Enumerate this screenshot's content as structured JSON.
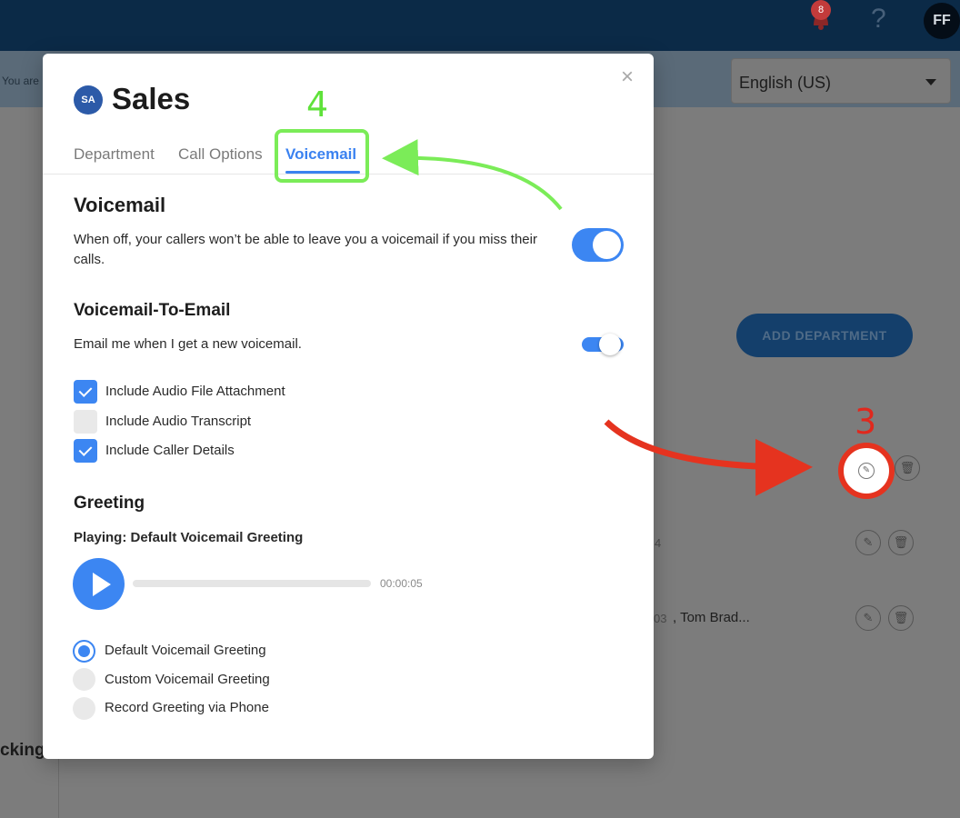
{
  "topbar": {
    "notification_count": "8",
    "help_icon": "?",
    "user_initials": "FF"
  },
  "subbar": {
    "notice_text": "You are",
    "language_value": "English (US)"
  },
  "background": {
    "add_department_label": "ADD DEPARTMENT",
    "row2_text": "4",
    "row3_faint": "03",
    "row3_text": ", Tom Brad...",
    "sidebar_text": "cking"
  },
  "modal": {
    "avatar_initials": "SA",
    "title": "Sales",
    "close_label": "×",
    "tabs": [
      {
        "label": "Department"
      },
      {
        "label": "Call Options"
      },
      {
        "label": "Voicemail"
      }
    ],
    "voicemail": {
      "heading": "Voicemail",
      "description": "When off, your callers won’t be able to leave you a voicemail if you miss their calls.",
      "enabled": true
    },
    "voicemail_to_email": {
      "heading": "Voicemail-To-Email",
      "description": "Email me when I get a new voicemail.",
      "enabled": true,
      "options": [
        {
          "label": "Include Audio File Attachment",
          "checked": true
        },
        {
          "label": "Include Audio Transcript",
          "checked": false
        },
        {
          "label": "Include Caller Details",
          "checked": true
        }
      ]
    },
    "greeting": {
      "heading": "Greeting",
      "playing_label": "Playing: Default Voicemail Greeting",
      "duration": "00:00:05",
      "options": [
        {
          "label": "Default Voicemail Greeting",
          "selected": true
        },
        {
          "label": "Custom Voicemail Greeting",
          "selected": false
        },
        {
          "label": "Record Greeting via Phone",
          "selected": false
        }
      ]
    }
  },
  "annotations": {
    "step4_label": "4",
    "step3_label": "3",
    "green_color": "#7bec58",
    "red_color": "#e5331f"
  },
  "colors": {
    "accent": "#3c86f2",
    "topbar": "#0b2a47"
  }
}
